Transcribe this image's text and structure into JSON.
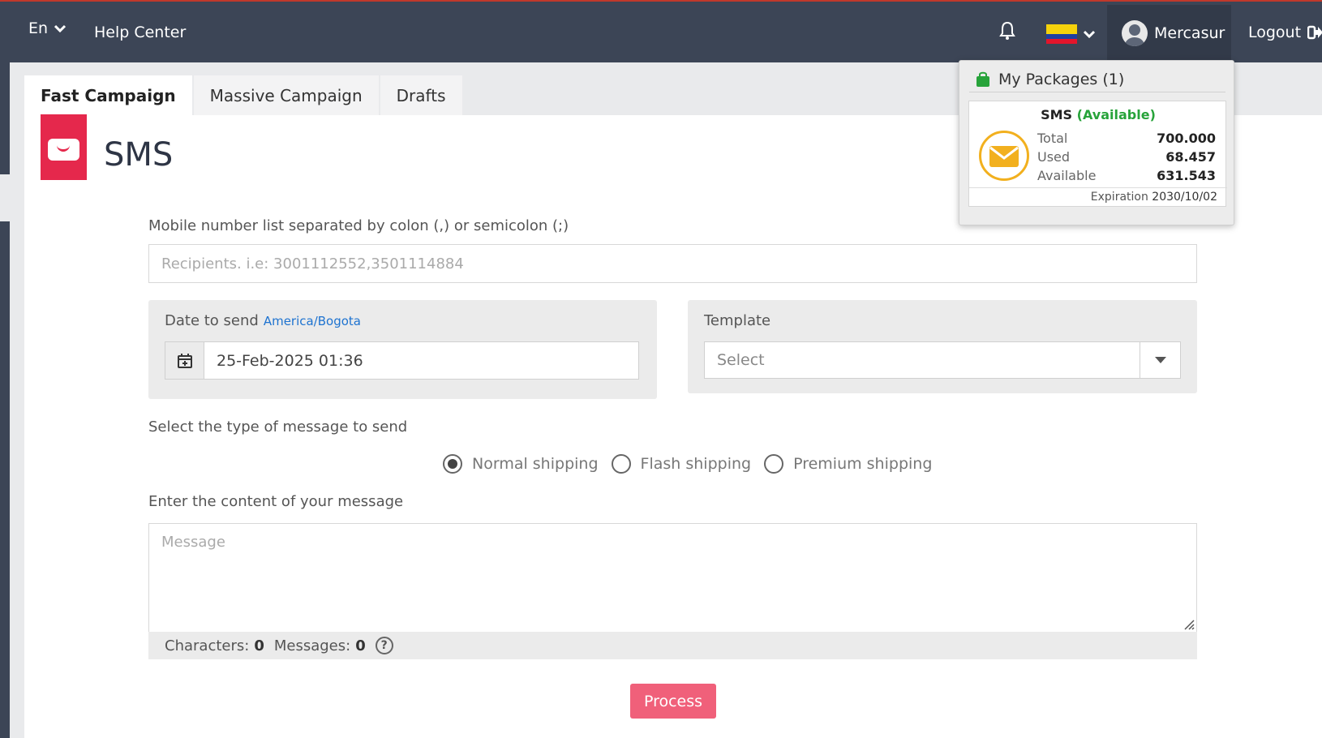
{
  "topbar": {
    "lang": "En",
    "help_center": "Help Center",
    "user_name": "Mercasur",
    "logout": "Logout",
    "flag_colors": [
      "#f5d20b",
      "#1f3fa0",
      "#e4152b"
    ]
  },
  "tabs": [
    {
      "label": "Fast Campaign",
      "active": true
    },
    {
      "label": "Massive Campaign",
      "active": false
    },
    {
      "label": "Drafts",
      "active": false
    }
  ],
  "page": {
    "title": "SMS",
    "accent_color": "#e5284c"
  },
  "form": {
    "recipients_label": "Mobile number list separated by colon (,) or semicolon (;)",
    "recipients_placeholder": "Recipients. i.e: 3001112552,3501114884",
    "date_label": "Date to send",
    "timezone": "America/Bogota",
    "date_value": "25-Feb-2025 01:36",
    "template_label": "Template",
    "template_value": "Select",
    "message_type_label": "Select the type of message to send",
    "message_types": [
      {
        "label": "Normal shipping",
        "selected": true
      },
      {
        "label": "Flash shipping",
        "selected": false
      },
      {
        "label": "Premium shipping",
        "selected": false
      }
    ],
    "content_label": "Enter the content of your message",
    "message_placeholder": "Message",
    "characters_label": "Characters:",
    "characters_value": "0",
    "messages_label": "Messages:",
    "messages_value": "0",
    "help_glyph": "?",
    "process_button": "Process",
    "process_color": "#f0607a"
  },
  "packages_popup": {
    "header": "My Packages (1)",
    "package_name": "SMS",
    "package_status": "(Available)",
    "rows": [
      {
        "label": "Total",
        "value": "700.000"
      },
      {
        "label": "Used",
        "value": "68.457"
      },
      {
        "label": "Available",
        "value": "631.543"
      }
    ],
    "expiration_label": "Expiration",
    "expiration_date": "2030/10/02"
  }
}
